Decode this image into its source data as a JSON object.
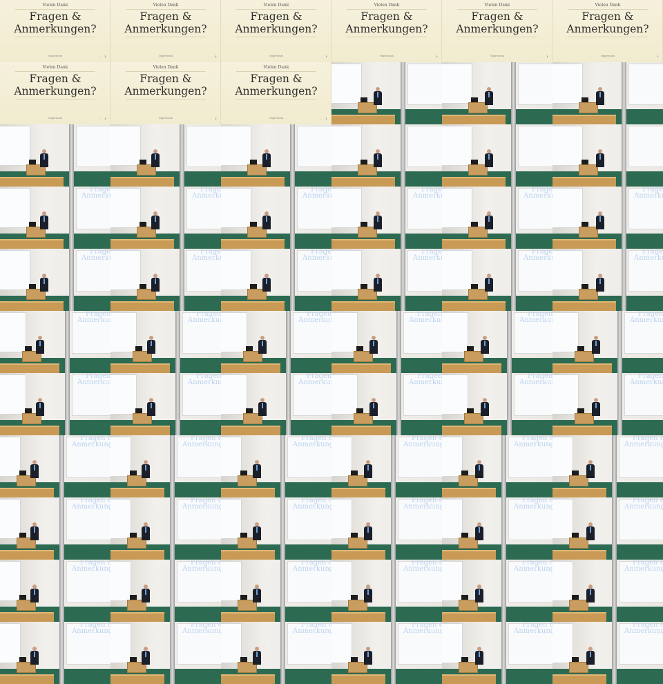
{
  "slide": {
    "header": "Vielen Dank",
    "title_line1": "Fragen &",
    "title_line2": "Anmerkungen?",
    "footer": "Impressum"
  },
  "screen_text": {
    "line1": "Fragen &",
    "line2": "Anmerkungen"
  },
  "colors": {
    "slide_background": "#f4efd8",
    "floor": "#2c6a52",
    "screen_text": "#bcd3ee"
  },
  "grid": {
    "columns": 6,
    "rows": 11,
    "slide_tile_count": 9
  }
}
